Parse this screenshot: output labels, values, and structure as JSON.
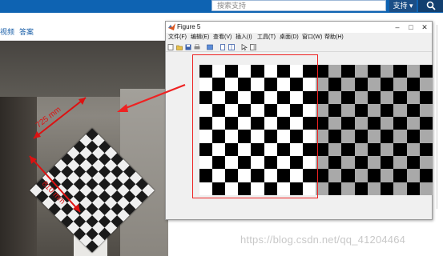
{
  "site": {
    "search_placeholder": "搜索支持",
    "support_label": "支持",
    "support_caret": "▾",
    "nav_left_1": "视频",
    "nav_left_2": "答案"
  },
  "photo": {
    "annotation_1": "725 mm",
    "annotation_2": "810 mm"
  },
  "figure_window": {
    "title": "Figure 5",
    "minimize": "–",
    "maximize": "□",
    "close": "✕",
    "menu": [
      "文件(F)",
      "编辑(E)",
      "查看(V)",
      "插入(I)",
      "工具(T)",
      "桌面(D)",
      "窗口(W)",
      "帮助(H)"
    ]
  },
  "watermark": "https://blog.csdn.net/qq_41204464",
  "colors": {
    "site_bar": "#0e63b2",
    "highlight": "#e22222",
    "check_black": "#000000",
    "check_white": "#ffffff",
    "check_gray": "#a9a9a9"
  }
}
